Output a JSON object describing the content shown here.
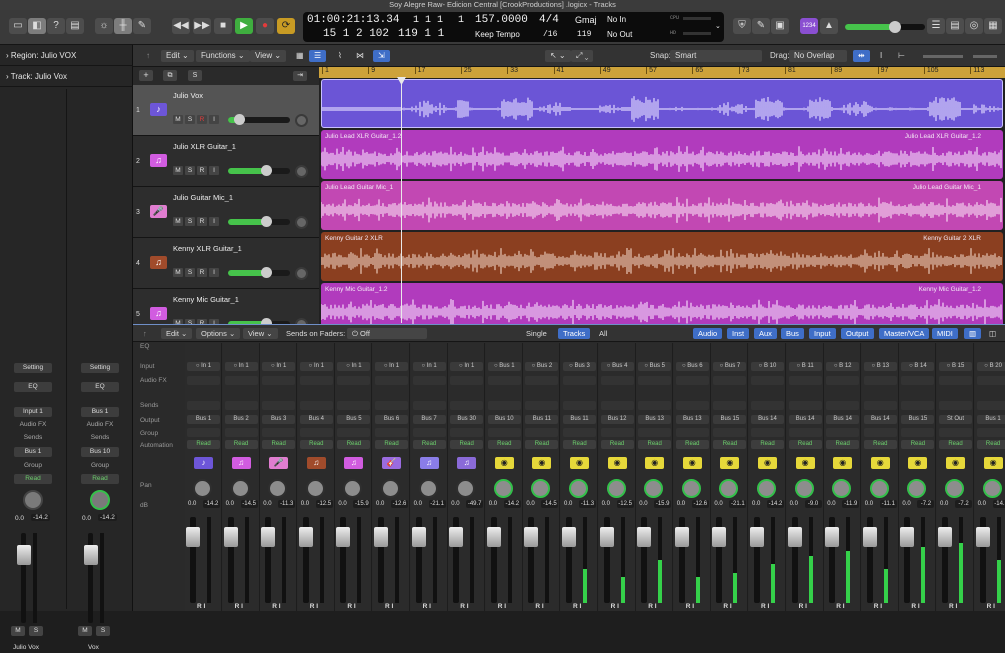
{
  "window_title": "Soy Alegre Raw- Edicion Central [CrookProductions] .logicx - Tracks",
  "lcd": {
    "time": "01:00:21:13.34",
    "bars_top": "1  1  1",
    "bars_top2": "1",
    "pos": "15  1  2  102",
    "pos2": "119  1  1",
    "tempo": "157.0000",
    "tempo_mode": "Keep Tempo",
    "sig": "4/4",
    "div": "/16",
    "key": "Gmaj",
    "key_val": "119",
    "in_label": "No In",
    "out_label": "No Out",
    "cpu": "CPU",
    "hd": "HD"
  },
  "badge_count": "1234",
  "inspector": {
    "region_label": "Region:",
    "region_value": "Julio VOX",
    "track_label": "Track:",
    "track_value": "Julio Vox"
  },
  "inspector_strips": [
    {
      "setting": "Setting",
      "eq": "EQ",
      "input": "Input 1",
      "fx": "Audio FX",
      "sends": "Sends",
      "output": "Bus 1",
      "group": "Group",
      "auto": "Read",
      "val1": "0.0",
      "val2": "-14.2",
      "m": "M",
      "s": "S",
      "name": "Julio Vox"
    },
    {
      "setting": "Setting",
      "eq": "EQ",
      "input": "Bus 1",
      "fx": "Audio FX",
      "sends": "Sends",
      "output": "Bus 10",
      "group": "Group",
      "auto": "Read",
      "val1": "0.0",
      "val2": "-14.2",
      "m": "M",
      "s": "S",
      "name": "Vox"
    }
  ],
  "track_menu": {
    "edit": "Edit",
    "functions": "Functions",
    "view": "View",
    "snap_label": "Snap:",
    "snap_value": "Smart",
    "drag_label": "Drag:",
    "drag_value": "No Overlap"
  },
  "tracks": [
    {
      "num": "1",
      "name": "Julio Vox",
      "color": "#6d56d8",
      "icon": "♪",
      "vol": 0.18
    },
    {
      "num": "2",
      "name": "Julio XLR Guitar_1",
      "color": "#d15ce0",
      "icon": "♫",
      "vol": 0.62
    },
    {
      "num": "3",
      "name": "Julio Guitar  Mic_1",
      "color": "#e07dd0",
      "icon": "🎤",
      "vol": 0.62
    },
    {
      "num": "4",
      "name": "Kenny XLR Guitar_1",
      "color": "#a04b2b",
      "icon": "♫",
      "vol": 0.62
    },
    {
      "num": "5",
      "name": "Kenny Mic Guitar_1",
      "color": "#d15ce0",
      "icon": "♫",
      "vol": 0.62
    }
  ],
  "track_buttons": {
    "m": "M",
    "s": "S",
    "r": "R",
    "i": "I"
  },
  "ruler": [
    "1",
    "9",
    "17",
    "25",
    "33",
    "41",
    "49",
    "57",
    "65",
    "73",
    "81",
    "89",
    "97",
    "105",
    "113"
  ],
  "regions": [
    {
      "label": "",
      "label_right": "",
      "color": "#6b55d6",
      "wave": "#e0d8ff"
    },
    {
      "label": "Julio Lead XLR Guitar_1.2",
      "label_right": "Julio Lead XLR Guitar_1.2",
      "color": "#b13bbd",
      "wave": "#f3d6f7"
    },
    {
      "label": "Julio Lead Guitar  Mic_1",
      "label_right": "Julio Lead Guitar  Mic_1",
      "color": "#c248b3",
      "wave": "#f6d9f1"
    },
    {
      "label": "Kenny Guitar 2 XLR",
      "label_right": "Kenny Guitar 2 XLR",
      "color": "#8b3f20",
      "wave": "#e6c6b6"
    },
    {
      "label": "Kenny Mic Guitar_1.2",
      "label_right": "Kenny Mic Guitar_1.2",
      "color": "#b13bbd",
      "wave": "#f3d6f7"
    }
  ],
  "mixer_menu": {
    "edit": "Edit",
    "options": "Options",
    "view": "View",
    "sends_label": "Sends on Faders:",
    "sends_value": "Off",
    "single": "Single",
    "tracks": "Tracks",
    "all": "All",
    "audio": "Audio",
    "inst": "Inst",
    "aux": "Aux",
    "bus": "Bus",
    "input": "Input",
    "output": "Output",
    "master": "Master/VCA",
    "midi": "MIDI"
  },
  "row_labels": {
    "eq": "EQ",
    "input": "Input",
    "fx": "Audio FX",
    "sends": "Sends",
    "output": "Output",
    "group": "Group",
    "automation": "Automation",
    "pan": "Pan",
    "db": "dB"
  },
  "channels": [
    {
      "input": "In 1",
      "output": "Bus 1",
      "auto": "Read",
      "db": "-14.2",
      "type": "audio",
      "color": "#6d56d8",
      "icon": "♪",
      "level": 0.0
    },
    {
      "input": "In 1",
      "output": "Bus 2",
      "auto": "Read",
      "db": "-14.5",
      "type": "audio",
      "color": "#d15ce0",
      "icon": "♫",
      "level": 0.0
    },
    {
      "input": "In 1",
      "output": "Bus 3",
      "auto": "Read",
      "db": "-11.3",
      "type": "audio",
      "color": "#e07dd0",
      "icon": "🎤",
      "level": 0.0
    },
    {
      "input": "In 1",
      "output": "Bus 4",
      "auto": "Read",
      "db": "-12.5",
      "type": "audio",
      "color": "#a04b2b",
      "icon": "♫",
      "level": 0.0
    },
    {
      "input": "In 1",
      "output": "Bus 5",
      "auto": "Read",
      "db": "-15.9",
      "type": "audio",
      "color": "#d15ce0",
      "icon": "♫",
      "level": 0.0
    },
    {
      "input": "In 1",
      "output": "Bus 6",
      "auto": "Read",
      "db": "-12.6",
      "type": "audio",
      "color": "#9a6be0",
      "icon": "🎸",
      "level": 0.0
    },
    {
      "input": "In 1",
      "output": "Bus 7",
      "auto": "Read",
      "db": "-21.1",
      "type": "audio",
      "color": "#8a7de8",
      "icon": "♫",
      "level": 0.0
    },
    {
      "input": "In 1",
      "output": "Bus 30",
      "auto": "Read",
      "db": "-49.7",
      "type": "audio",
      "color": "#8a6ad8",
      "icon": "♫",
      "level": 0.0
    },
    {
      "input": "Bus 1",
      "output": "Bus 10",
      "auto": "Read",
      "db": "-14.2",
      "type": "aux",
      "color": "#e6d83a",
      "icon": "◉",
      "level": 0.0
    },
    {
      "input": "Bus 2",
      "output": "Bus 11",
      "auto": "Read",
      "db": "-14.5",
      "type": "aux",
      "color": "#e6d83a",
      "icon": "◉",
      "level": 0.0
    },
    {
      "input": "Bus 3",
      "output": "Bus 11",
      "auto": "Read",
      "db": "-11.3",
      "type": "aux",
      "color": "#e6d83a",
      "icon": "◉",
      "level": 0.4
    },
    {
      "input": "Bus 4",
      "output": "Bus 12",
      "auto": "Read",
      "db": "-12.5",
      "type": "aux",
      "color": "#e6d83a",
      "icon": "◉",
      "level": 0.3
    },
    {
      "input": "Bus 5",
      "output": "Bus 13",
      "auto": "Read",
      "db": "-15.9",
      "type": "aux",
      "color": "#e6d83a",
      "icon": "◉",
      "level": 0.5
    },
    {
      "input": "Bus 6",
      "output": "Bus 13",
      "auto": "Read",
      "db": "-12.6",
      "type": "aux",
      "color": "#e6d83a",
      "icon": "◉",
      "level": 0.3
    },
    {
      "input": "Bus 7",
      "output": "Bus 15",
      "auto": "Read",
      "db": "-21.1",
      "type": "aux",
      "color": "#e6d83a",
      "icon": "◉",
      "level": 0.35
    },
    {
      "input": "B 10",
      "output": "Bus 14",
      "auto": "Read",
      "db": "-14.2",
      "type": "aux",
      "color": "#e6d83a",
      "icon": "◉",
      "level": 0.45
    },
    {
      "input": "B 11",
      "output": "Bus 14",
      "auto": "Read",
      "db": "-9.0",
      "type": "aux",
      "color": "#e6d83a",
      "icon": "◉",
      "level": 0.55
    },
    {
      "input": "B 12",
      "output": "Bus 14",
      "auto": "Read",
      "db": "-11.9",
      "type": "aux",
      "color": "#e6d83a",
      "icon": "◉",
      "level": 0.6
    },
    {
      "input": "B 13",
      "output": "Bus 14",
      "auto": "Read",
      "db": "-11.1",
      "type": "aux",
      "color": "#e6d83a",
      "icon": "◉",
      "level": 0.4
    },
    {
      "input": "B 14",
      "output": "Bus 15",
      "auto": "Read",
      "db": "-7.2",
      "type": "aux",
      "color": "#e6d83a",
      "icon": "◉",
      "level": 0.65
    },
    {
      "input": "B 15",
      "output": "St Out",
      "auto": "Read",
      "db": "-7.2",
      "type": "aux",
      "color": "#e6d83a",
      "icon": "◉",
      "level": 0.7
    },
    {
      "input": "B 20",
      "output": "Bus 1",
      "auto": "Read",
      "db": "-14.2",
      "type": "aux",
      "color": "#e6d83a",
      "icon": "◉",
      "level": 0.5
    }
  ],
  "channel_val": "0.0",
  "ri_label": "R I"
}
